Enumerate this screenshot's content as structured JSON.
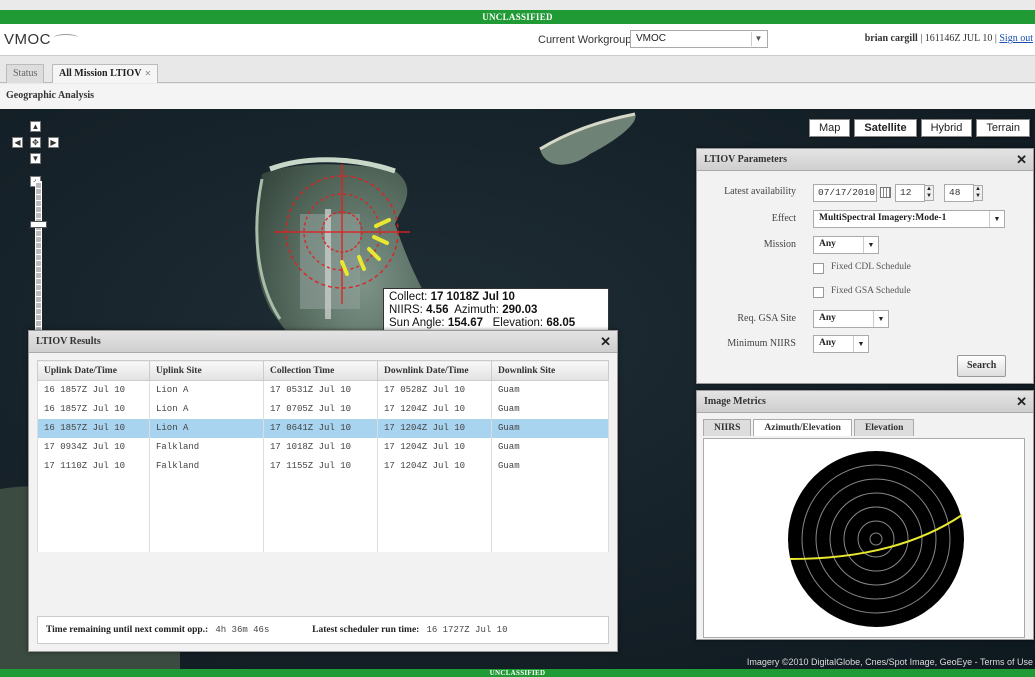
{
  "classification": {
    "top": "UNCLASSIFIED",
    "bottom": "UNCLASSIFIED"
  },
  "header": {
    "logo": "VMOC",
    "workgroup_label": "Current Workgroup:",
    "workgroup_value": "VMOC",
    "user_name": "brian cargill",
    "user_time": "| 161146Z JUL 10 |",
    "signout_label": "Sign out"
  },
  "tabs": [
    {
      "label": "Status"
    },
    {
      "label": "All Mission LTIOV"
    }
  ],
  "section_title": "Geographic Analysis",
  "map": {
    "types": [
      "Map",
      "Satellite",
      "Hybrid",
      "Terrain"
    ],
    "active_type": "Satellite",
    "credits": "Imagery ©2010 DigitalGlobe, Cnes/Spot Image, GeoEye - Terms of Use",
    "info": {
      "collect_label": "Collect:",
      "collect_value": "17 1018Z Jul 10",
      "niirs_label": "NIIRS:",
      "niirs_value": "4.56",
      "azimuth_label": "Azimuth:",
      "azimuth_value": "290.03",
      "sun_label": "Sun Angle:",
      "sun_value": "154.67",
      "elevation_label": "Elevation:",
      "elevation_value": "68.05"
    }
  },
  "ltiov_params": {
    "title": "LTIOV Parameters",
    "latest_label": "Latest availability",
    "date_value": "07/17/2010",
    "hour_value": "12",
    "minute_value": "48",
    "effect_label": "Effect",
    "effect_value": "MultiSpectral Imagery:Mode-1",
    "mission_label": "Mission",
    "mission_value": "Any",
    "fixed_cdl_label": "Fixed CDL Schedule",
    "fixed_gsa_label": "Fixed GSA Schedule",
    "req_gsa_label": "Req. GSA Site",
    "req_gsa_value": "Any",
    "min_niirs_label": "Minimum NIIRS",
    "min_niirs_value": "Any",
    "search_label": "Search"
  },
  "image_metrics": {
    "title": "Image Metrics",
    "tabs": [
      "NIIRS",
      "Azimuth/Elevation",
      "Elevation"
    ],
    "active_tab": "Azimuth/Elevation"
  },
  "results": {
    "title": "LTIOV Results",
    "columns": [
      "Uplink Date/Time",
      "Uplink Site",
      "Collection Time",
      "Downlink Date/Time",
      "Downlink Site"
    ],
    "rows": [
      [
        "16 1857Z Jul 10",
        "Lion A",
        "17 0531Z Jul 10",
        "17 0528Z Jul 10",
        "Guam"
      ],
      [
        "16 1857Z Jul 10",
        "Lion A",
        "17 0705Z Jul 10",
        "17 1204Z Jul 10",
        "Guam"
      ],
      [
        "16 1857Z Jul 10",
        "Lion A",
        "17 0641Z Jul 10",
        "17 1204Z Jul 10",
        "Guam"
      ],
      [
        "17 0934Z Jul 10",
        "Falkland",
        "17 1018Z Jul 10",
        "17 1204Z Jul 10",
        "Guam"
      ],
      [
        "17 1110Z Jul 10",
        "Falkland",
        "17 1155Z Jul 10",
        "17 1204Z Jul 10",
        "Guam"
      ]
    ],
    "selected_row": 2,
    "time_remaining_label": "Time remaining until next commit opp.:",
    "time_remaining_value": "4h 36m 46s",
    "scheduler_label": "Latest scheduler run time:",
    "scheduler_value": "16 1727Z Jul 10"
  },
  "colors": {
    "classification_bar": "#1f9a34",
    "selected_row": "#a8d4f0",
    "sensor_marker": "#e02020",
    "track_line": "#e8e830"
  }
}
